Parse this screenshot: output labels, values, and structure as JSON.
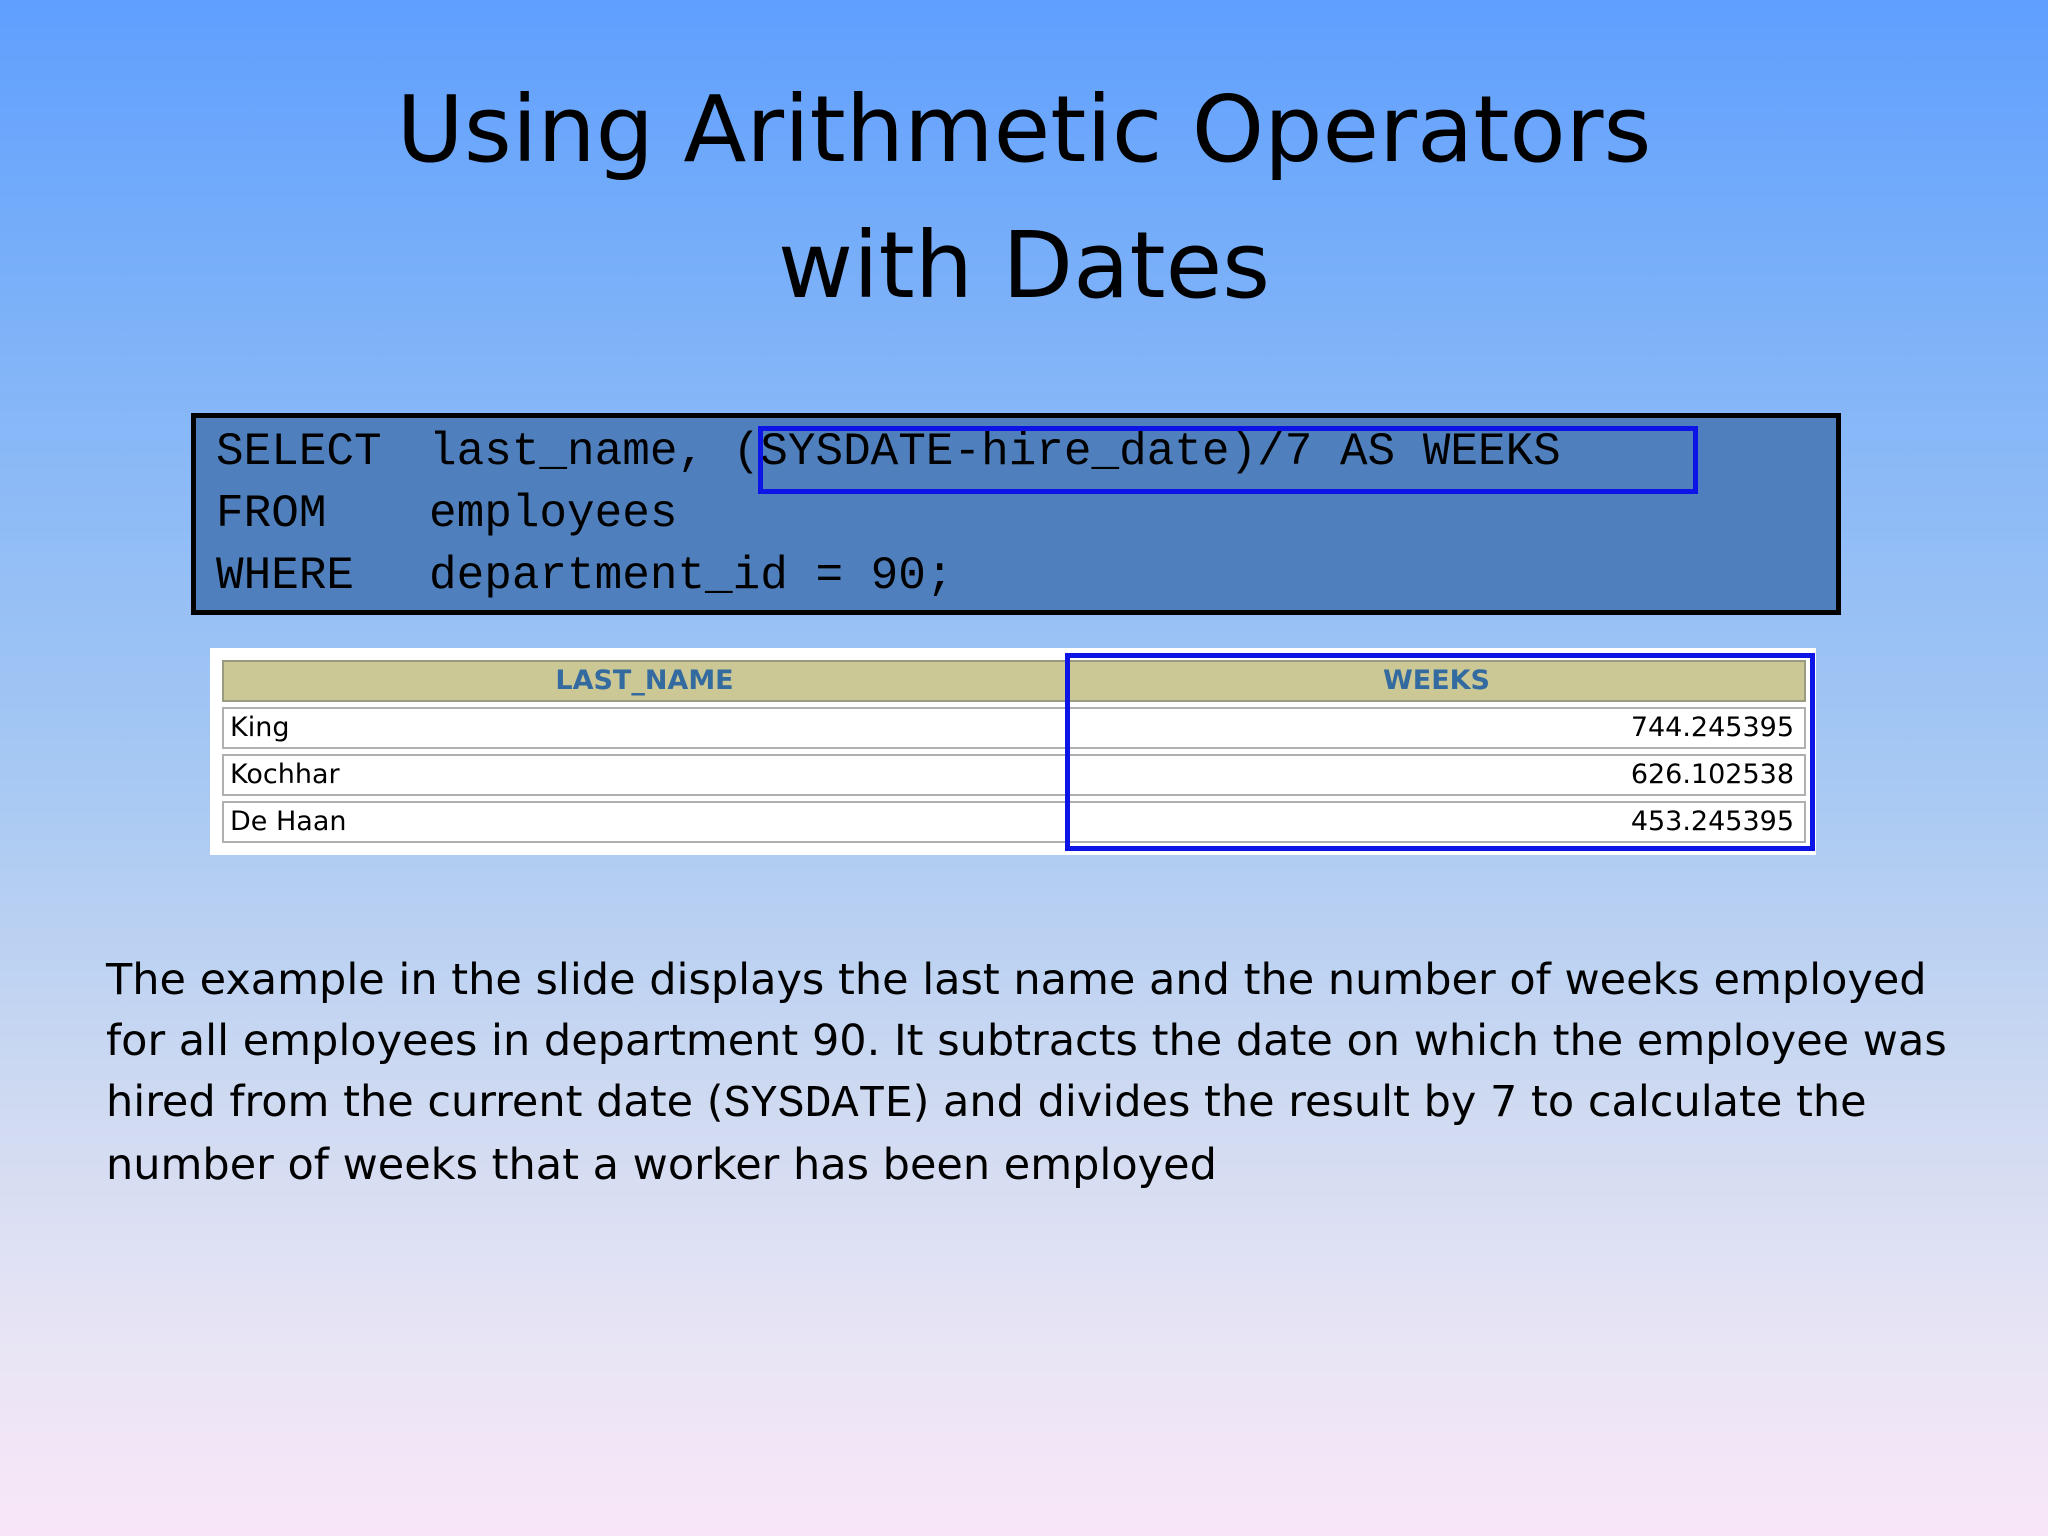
{
  "slide": {
    "title_line1": "Using Arithmetic Operators",
    "title_line2": "with Dates"
  },
  "code": {
    "line1_keyword": "SELECT",
    "line1_rest": "last_name, ",
    "line1_highlight": "(SYSDATE-hire_date)/7 AS WEEKS",
    "line2_keyword": "FROM",
    "line2_rest": "employees",
    "line3_keyword": "WHERE",
    "line3_rest": "department_id = 90;"
  },
  "result_table": {
    "columns": [
      "LAST_NAME",
      "WEEKS"
    ],
    "rows": [
      {
        "last_name": "King",
        "weeks": "744.245395"
      },
      {
        "last_name": "Kochhar",
        "weeks": "626.102538"
      },
      {
        "last_name": "De Haan",
        "weeks": "453.245395"
      }
    ]
  },
  "description": {
    "part1": "The example in the slide displays the last name and the number of weeks employed for all employees in department 90. It subtracts the date on which the employee was hired from the current date (",
    "code_term": "SYSDATE",
    "part2": ") and divides the result by 7 to calculate the number of weeks that a worker has been employed"
  },
  "colors": {
    "code_box_bg": "#4f80bd",
    "highlight_border": "#0c14e6",
    "table_header_bg": "#cbc896",
    "table_header_text": "#336a9f"
  }
}
